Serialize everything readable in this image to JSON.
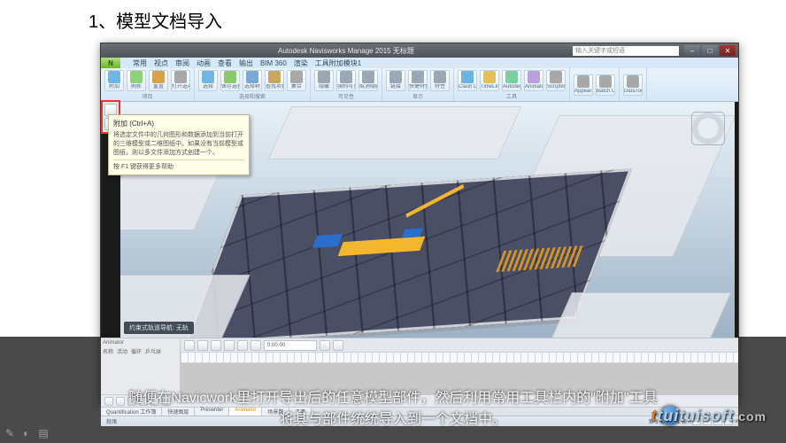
{
  "heading": "1、模型文档导入",
  "caption_line1": "随便在Navicwork里打开导出后的任意模型部件，然后利用常用工具栏内的\"附加\"工具",
  "caption_line2": "将其与部件统统导入到一个文档中。",
  "watermark": {
    "main": "tuituisoft",
    "tld": ".com"
  },
  "app": {
    "title": "Autodesk Navisworks Manage 2015 无标题",
    "search_placeholder": "输入关键字或短语",
    "win_buttons": {
      "min": "–",
      "max": "□",
      "close": "✕"
    },
    "appmenu_letter": "N",
    "menubar": [
      "常用",
      "视点",
      "审阅",
      "动画",
      "查看",
      "输出",
      "BIM 360",
      "渲染",
      "工具附加模块1"
    ],
    "ribbon_groups": [
      {
        "title": "项目",
        "buttons": [
          {
            "name": "append-button",
            "label": "附加",
            "color": "#6fb6e6"
          },
          {
            "name": "refresh-button",
            "label": "刷新",
            "color": "#8fd07a"
          },
          {
            "name": "reset-button",
            "label": "重置",
            "color": "#d9a24a"
          },
          {
            "name": "options-button",
            "label": "打开选项",
            "color": "#a9a9a9"
          }
        ]
      },
      {
        "title": "选择和搜索",
        "buttons": [
          {
            "name": "select-button",
            "label": "选择",
            "color": "#6fb6e6"
          },
          {
            "name": "save-selection-button",
            "label": "保存选择",
            "color": "#88c96e"
          },
          {
            "name": "selection-tree-button",
            "label": "选择树",
            "color": "#7aa7d6"
          },
          {
            "name": "find-items-button",
            "label": "查找项目",
            "color": "#caa85b"
          },
          {
            "name": "sets-button",
            "label": "集合",
            "color": "#a9a9a9"
          }
        ]
      },
      {
        "title": "可见性",
        "buttons": [
          {
            "name": "hide-button",
            "label": "隐藏",
            "color": "#9aa8b6"
          },
          {
            "name": "require-button",
            "label": "强制可见",
            "color": "#9aa8b6"
          },
          {
            "name": "unhide-button",
            "label": "取消隐藏",
            "color": "#9aa8b6"
          }
        ]
      },
      {
        "title": "显示",
        "buttons": [
          {
            "name": "links-button",
            "label": "链接",
            "color": "#9aa8b6"
          },
          {
            "name": "quickprops-button",
            "label": "快捷特性",
            "color": "#9aa8b6"
          },
          {
            "name": "properties-button",
            "label": "特性",
            "color": "#9aa8b6"
          }
        ]
      },
      {
        "title": "工具",
        "buttons": [
          {
            "name": "clash-button",
            "label": "Clash Detective",
            "color": "#6bb3e0"
          },
          {
            "name": "timeliner-button",
            "label": "TimeLiner",
            "color": "#e2c15a"
          },
          {
            "name": "rendering-button",
            "label": "Autodesk Rendering",
            "color": "#7bd0a0"
          },
          {
            "name": "animator-button",
            "label": "Animator",
            "color": "#bba0e0"
          },
          {
            "name": "scripter-button",
            "label": "Scripter",
            "color": "#a9a9a9"
          }
        ]
      },
      {
        "title": "",
        "buttons": [
          {
            "name": "appearance-profiler-button",
            "label": "Appearance Profiler",
            "color": "#a9a9a9"
          },
          {
            "name": "batch-utility-button",
            "label": "Batch Utility",
            "color": "#a9a9a9"
          }
        ]
      },
      {
        "title": "",
        "buttons": [
          {
            "name": "datatools-button",
            "label": "DataTools",
            "color": "#a9a9a9"
          }
        ]
      }
    ],
    "tooltip": {
      "title": "附加 (Ctrl+A)",
      "body": "将选定文件中的几何图形和数据添加到当前打开的三维模型或二维图纸中。如果没有当前模型或图纸，则以多文件添加方式创建一个。",
      "hint": "按 F1 键获得更多帮助"
    },
    "viewport_status": "约束式轨道导航: 无轨",
    "animator": {
      "panel_label": "Animator",
      "columns": [
        "名称",
        "活动",
        "循环",
        "乒乓球"
      ],
      "time": "0:00.00"
    },
    "bottom_tabs": [
      "Quantification 工作簿",
      "快速图层",
      "Presenter",
      "Animator",
      "场景数",
      "工具"
    ],
    "active_tab_index": 3,
    "statusbar_left": "就绪",
    "statusbar_right": "第 1 张，共 1 张"
  }
}
